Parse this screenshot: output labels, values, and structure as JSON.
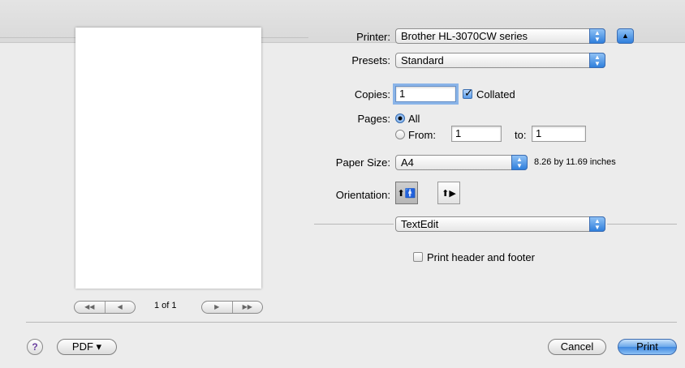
{
  "preview": {
    "page_indicator": "1 of 1",
    "nav_first": "◀◀",
    "nav_prev": "◀",
    "nav_next": "▶",
    "nav_last": "▶▶"
  },
  "printer": {
    "label": "Printer:",
    "value": "Brother HL-3070CW series"
  },
  "presets": {
    "label": "Presets:",
    "value": "Standard"
  },
  "copies": {
    "label": "Copies:",
    "value": "1",
    "collated_label": "Collated",
    "collated_checked": true
  },
  "pages": {
    "label": "Pages:",
    "all_label": "All",
    "from_label": "From:",
    "from_value": "1",
    "to_label": "to:",
    "to_value": "1",
    "selected": "All"
  },
  "paper_size": {
    "label": "Paper Size:",
    "value": "A4",
    "dimensions": "8.26 by 11.69 inches"
  },
  "orientation": {
    "label": "Orientation:",
    "selected": "portrait"
  },
  "app_section": {
    "value": "TextEdit",
    "print_header_footer_label": "Print header and footer",
    "print_header_footer_checked": false
  },
  "footer": {
    "help_label": "?",
    "pdf_label": "PDF ▾",
    "cancel_label": "Cancel",
    "print_label": "Print"
  },
  "colors": {
    "accent": "#3f88e0",
    "window_bg": "#ececec"
  }
}
